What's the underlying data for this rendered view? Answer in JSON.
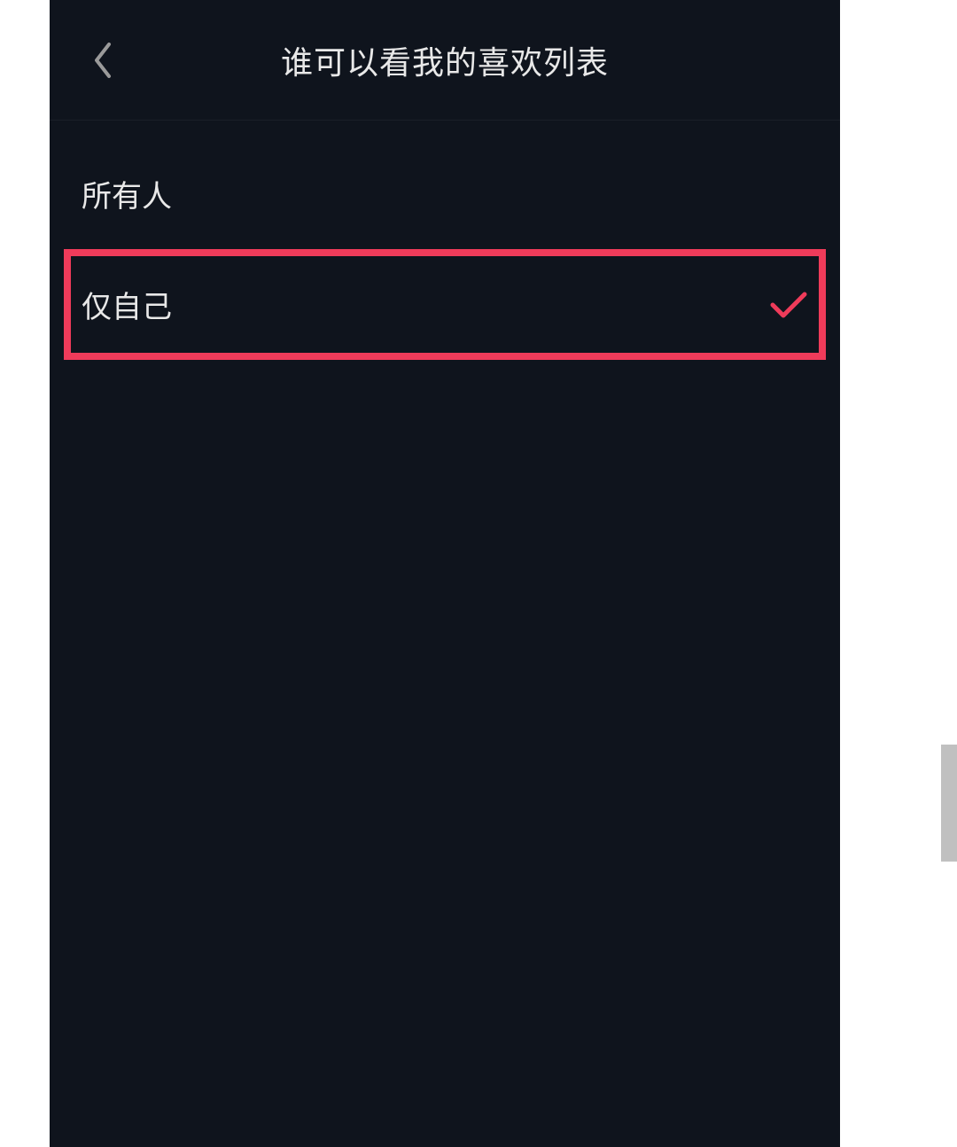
{
  "header": {
    "title": "谁可以看我的喜欢列表"
  },
  "options": [
    {
      "label": "所有人",
      "selected": false,
      "highlighted": false
    },
    {
      "label": "仅自己",
      "selected": true,
      "highlighted": true
    }
  ],
  "colors": {
    "accent": "#ef3b5a",
    "background": "#0f141d",
    "text": "#e8e8e8"
  }
}
